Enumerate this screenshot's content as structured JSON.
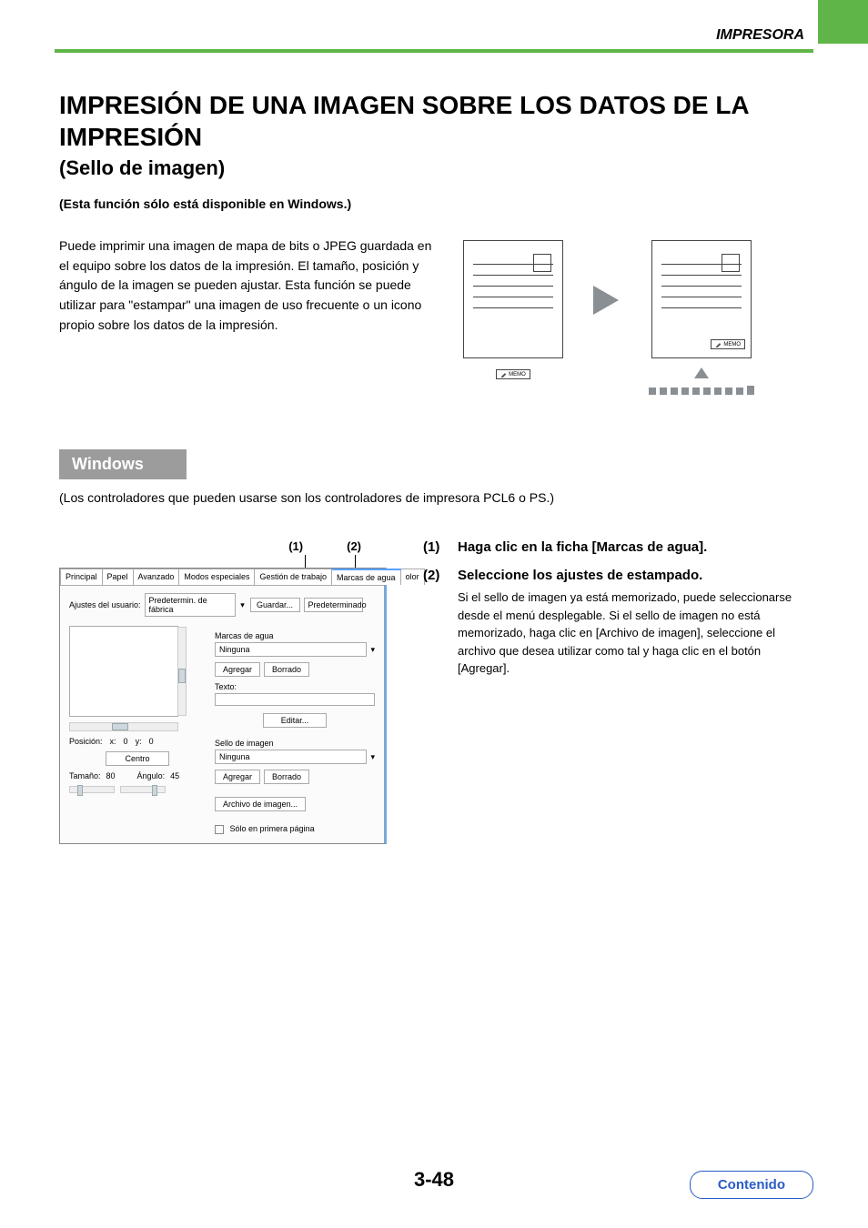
{
  "header": {
    "category": "IMPRESORA"
  },
  "title": {
    "main": "IMPRESIÓN DE UNA IMAGEN SOBRE LOS DATOS DE LA IMPRESIÓN",
    "sub": "(Sello de imagen)"
  },
  "note": "(Esta función sólo está disponible en Windows.)",
  "description": "Puede imprimir una imagen de mapa de bits o JPEG guardada en el equipo sobre los datos de la impresión. El tamaño, posición y ángulo de la imagen se pueden ajustar. Esta función se puede utilizar para \"estampar\" una imagen de uso frecuente o un icono propio sobre los datos de la impresión.",
  "memo_label": "MEMO",
  "windows": {
    "heading": "Windows",
    "note": "(Los controladores que pueden usarse son los controladores de impresora PCL6 o PS.)"
  },
  "callouts": {
    "c1": "(1)",
    "c2": "(2)"
  },
  "dialog": {
    "tabs": [
      "Principal",
      "Papel",
      "Avanzado",
      "Modos especiales",
      "Gestión de trabajo",
      "Marcas de agua",
      "olor"
    ],
    "active_tab": 5,
    "user_settings_label": "Ajustes del usuario:",
    "user_settings_value": "Predetermin. de fábrica",
    "save_btn": "Guardar...",
    "defaults_btn": "Predeterminado",
    "watermark_label": "Marcas de agua",
    "watermark_value": "Ninguna",
    "add_btn": "Agregar",
    "delete_btn": "Borrado",
    "text_label": "Texto:",
    "edit_btn": "Editar...",
    "stamp_label": "Sello de imagen",
    "stamp_value": "Ninguna",
    "image_file_btn": "Archivo de imagen...",
    "first_page_only": "Sólo en primera página",
    "position_label": "Posición:",
    "pos_x_label": "x:",
    "pos_x": "0",
    "pos_y_label": "y:",
    "pos_y": "0",
    "center_btn": "Centro",
    "size_label": "Tamaño:",
    "size_value": "80",
    "angle_label": "Ángulo:",
    "angle_value": "45"
  },
  "steps": [
    {
      "num": "(1)",
      "title": "Haga clic en la ficha [Marcas de agua]."
    },
    {
      "num": "(2)",
      "title": "Seleccione los ajustes de estampado.",
      "body": "Si el sello de imagen ya está memorizado, puede seleccionarse desde el menú desplegable.\nSi el sello de imagen no está memorizado, haga clic en [Archivo de imagen], seleccione el archivo que desea utilizar como tal y haga clic en el botón [Agregar]."
    }
  ],
  "pagenum": "3-48",
  "contents": "Contenido"
}
